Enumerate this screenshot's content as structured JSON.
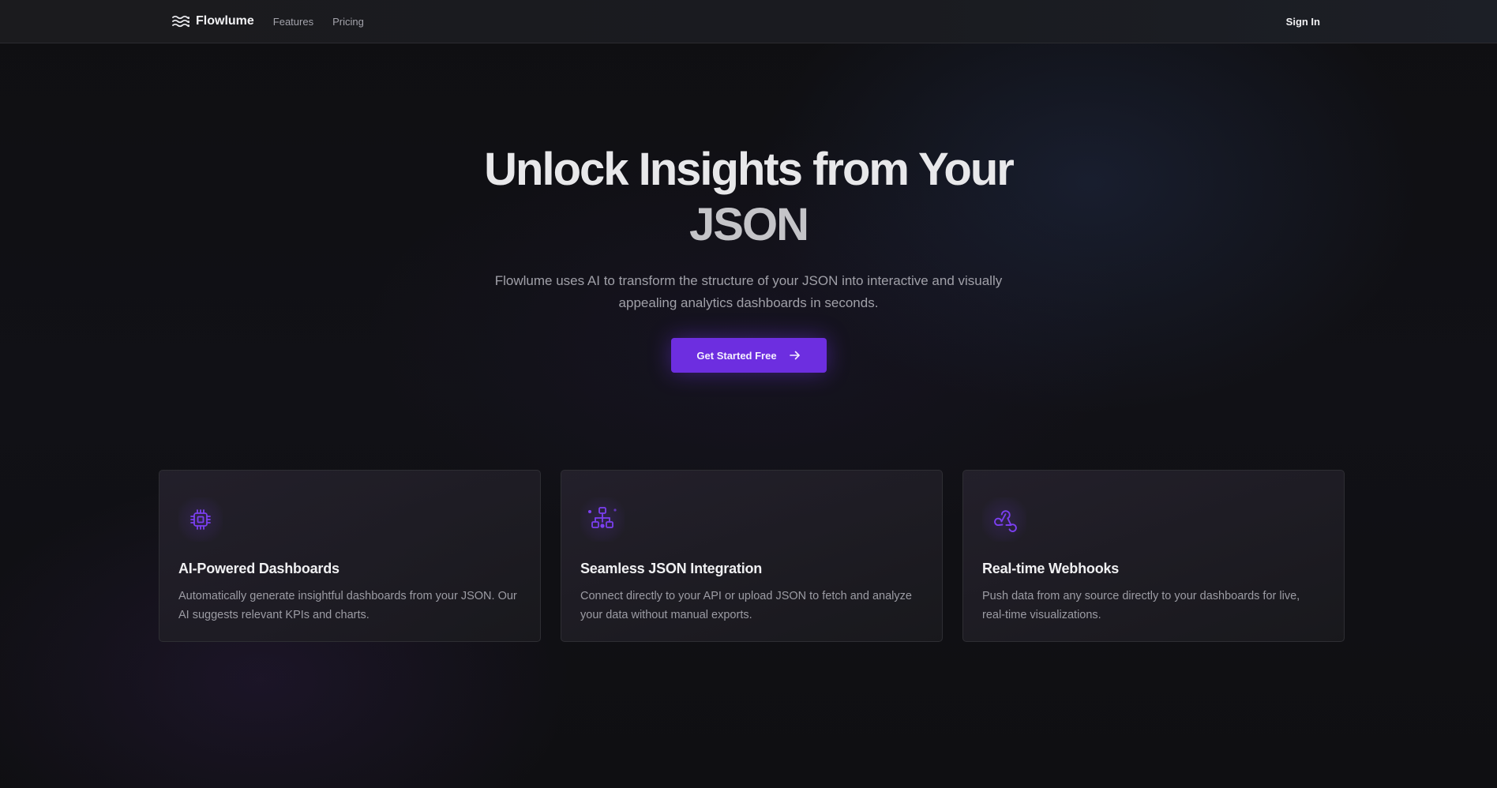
{
  "nav": {
    "brand": "Flowlume",
    "links": [
      "Features",
      "Pricing"
    ],
    "sign_in": "Sign In"
  },
  "hero": {
    "title_line1": "Unlock Insights from Your",
    "title_line2": "JSON",
    "subtitle": "Flowlume uses AI to transform the structure of your JSON into interactive and visually appealing analytics dashboards in seconds.",
    "cta_label": "Get Started Free"
  },
  "features": [
    {
      "icon": "cpu-chip-icon",
      "title": "AI-Powered Dashboards",
      "description": "Automatically generate insightful dashboards from your JSON. Our AI suggests relevant KPIs and charts."
    },
    {
      "icon": "hierarchy-network-icon",
      "title": "Seamless JSON Integration",
      "description": "Connect directly to your API or upload JSON to fetch and analyze your data without manual exports."
    },
    {
      "icon": "webhook-icon",
      "title": "Real-time Webhooks",
      "description": "Push data from any source directly to your dashboards for live, real-time visualizations."
    }
  ],
  "colors": {
    "accent": "#6d2ee0",
    "icon_purple": "#7b3ff0",
    "background": "#0e0e11",
    "nav_background": "#1b1b1e"
  }
}
